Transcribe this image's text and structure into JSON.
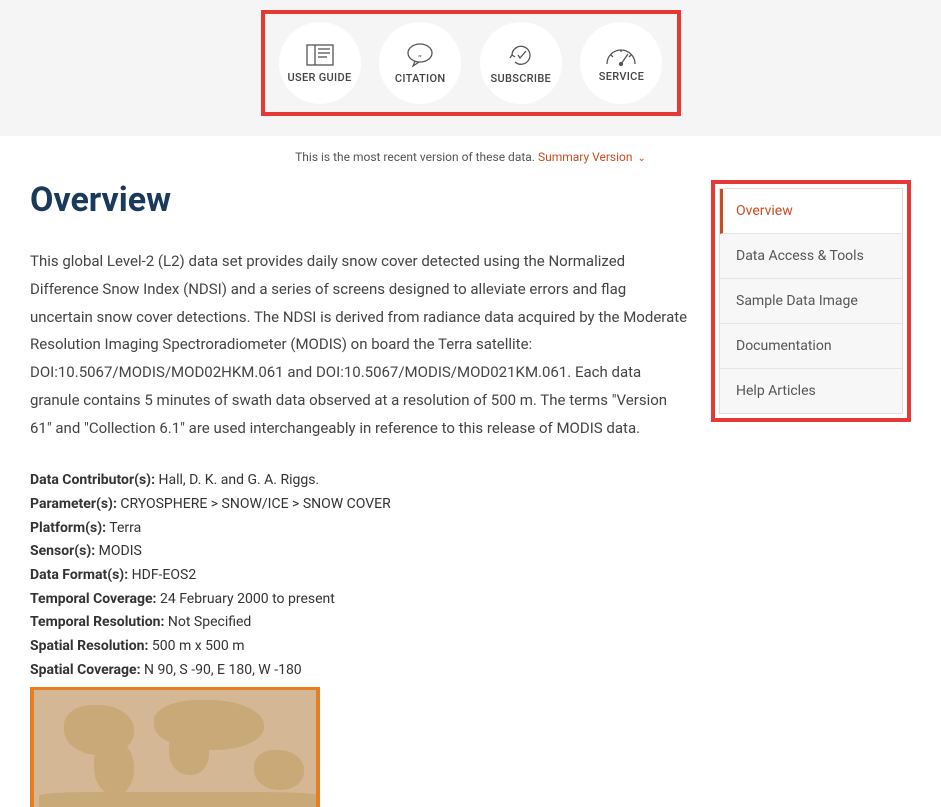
{
  "toolbar": {
    "user_guide": "USER GUIDE",
    "citation": "CITATION",
    "subscribe": "SUBSCRIBE",
    "service": "SERVICE"
  },
  "version_notice": {
    "text": "This is the most recent version of these data.",
    "link": "Summary Version"
  },
  "page_title": "Overview",
  "description": "This global Level-2 (L2) data set provides daily snow cover detected using the Normalized Difference Snow Index (NDSI) and a series of screens designed to alleviate errors and flag uncertain snow cover detections. The NDSI is derived from radiance data acquired by the Moderate Resolution Imaging Spectroradiometer (MODIS) on board the Terra satellite: DOI:10.5067/MODIS/MOD02HKM.061 and DOI:10.5067/MODIS/MOD021KM.061. Each data granule contains 5 minutes of swath data observed at a resolution of 500 m. The terms \"Version 61\" and \"Collection 6.1\" are used interchangeably in reference to this release of MODIS data.",
  "metadata": {
    "contributors_label": "Data Contributor(s):",
    "contributors_value": " Hall, D. K. and G. A. Riggs.",
    "parameters_label": "Parameter(s):",
    "parameters_value": "  CRYOSPHERE >  SNOW/ICE >  SNOW COVER",
    "platforms_label": "Platform(s):",
    "platforms_value": " Terra",
    "sensors_label": "Sensor(s):",
    "sensors_value": " MODIS",
    "formats_label": "Data Format(s):",
    "formats_value": " HDF-EOS2",
    "temporal_coverage_label": "Temporal Coverage:",
    "temporal_coverage_value": " 24 February 2000 to present",
    "temporal_resolution_label": "Temporal Resolution:",
    "temporal_resolution_value": " Not Specified",
    "spatial_resolution_label": "Spatial Resolution:",
    "spatial_resolution_value": " 500 m  x 500 m",
    "spatial_coverage_label": "Spatial Coverage:",
    "spatial_coverage_value": " N 90,  S -90,  E 180,  W -180"
  },
  "sidebar": {
    "items": [
      {
        "label": "Overview",
        "active": true
      },
      {
        "label": "Data Access & Tools",
        "active": false
      },
      {
        "label": "Sample Data Image",
        "active": false
      },
      {
        "label": "Documentation",
        "active": false
      },
      {
        "label": "Help Articles",
        "active": false
      }
    ]
  }
}
